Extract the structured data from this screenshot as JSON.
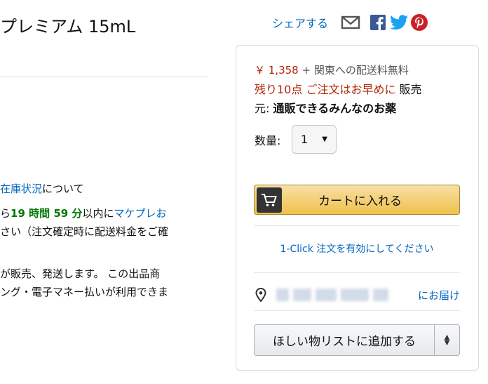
{
  "product": {
    "title": "プレミアム 15mL"
  },
  "left_info": {
    "stock_link": "在庫状況",
    "stock_suffix": "について",
    "delivery_prefix": "ら",
    "delivery_time": "19 時間 59 分",
    "delivery_mid": "以内に",
    "delivery_link": "マケプレお",
    "delivery_line2": "さい（注文確定時に配送料金をご確",
    "seller_line1": "が販売、発送します。 この出品商",
    "seller_line2": "ング・電子マネー払いが利用できま"
  },
  "share": {
    "label": "シェアする",
    "icons": [
      "mail-icon",
      "facebook-icon",
      "twitter-icon",
      "pinterest-icon"
    ],
    "colors": {
      "facebook": "#3b5998",
      "twitter": "#1da1f2",
      "pinterest": "#cb2027"
    }
  },
  "buybox": {
    "price": "￥ 1,358",
    "shipping": "+ 関東への配送料無料",
    "stock": "残り10点 ご注文はお早めに",
    "sold_by_label": "販売",
    "seller_label": "元:",
    "seller_name": "通販できるみんなのお薬",
    "qty_label": "数量:",
    "qty_value": "1",
    "add_to_cart": "カートに入れる",
    "one_click": "1-Click 注文を有効にしてください",
    "deliver_to": "にお届け",
    "wishlist": "ほしい物リストに追加する"
  },
  "colors": {
    "price": "#b12704",
    "link": "#0066c0",
    "highlight_green": "#007600",
    "cart_button": "#f0c14b"
  }
}
